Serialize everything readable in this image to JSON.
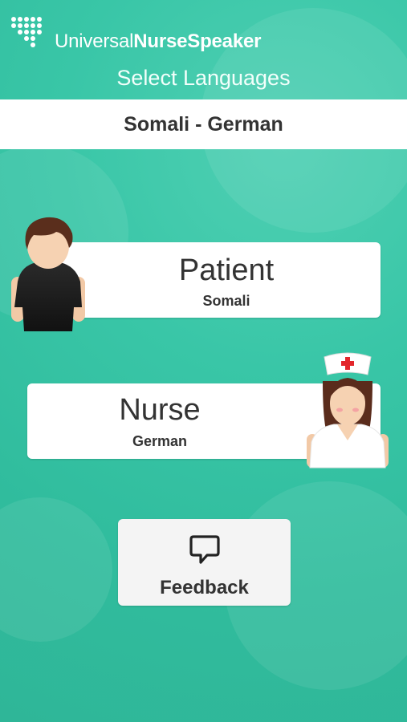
{
  "app": {
    "logo_text_regular": "Universal",
    "logo_text_bold": "NurseSpeaker",
    "screen_title": "Select Languages"
  },
  "language_pair": "Somali - German",
  "patient": {
    "role": "Patient",
    "language": "Somali"
  },
  "nurse": {
    "role": "Nurse",
    "language": "German"
  },
  "feedback": {
    "label": "Feedback",
    "icon": "speech-bubble-icon"
  },
  "colors": {
    "background": "#35c3a4",
    "card": "#ffffff",
    "text": "#333333"
  }
}
